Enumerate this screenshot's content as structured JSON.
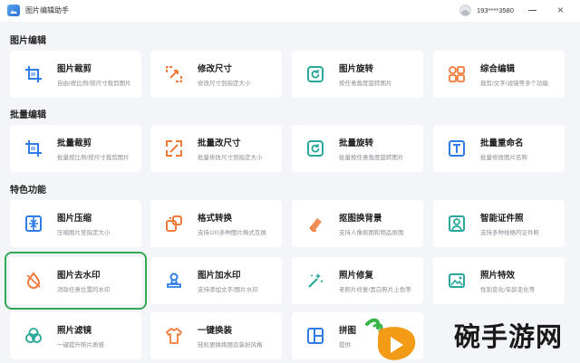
{
  "window": {
    "app_title": "图片编辑助手",
    "user_id": "193****3580",
    "minimize_glyph": "—",
    "close_glyph": "×"
  },
  "sections": {
    "picture_edit": "图片编辑",
    "batch_edit": "批量编辑",
    "features": "特色功能"
  },
  "cards": {
    "crop": {
      "name": "图片裁剪",
      "desc": "自由/按比例/按尺寸裁剪图片",
      "icon": "crop-icon"
    },
    "resize": {
      "name": "修改尺寸",
      "desc": "修改尺寸到指定大小",
      "icon": "resize-icon"
    },
    "rotate": {
      "name": "图片旋转",
      "desc": "按任意角度旋转图片",
      "icon": "rotate-icon"
    },
    "combo": {
      "name": "综合编辑",
      "desc": "裁剪/文字/滤镜等多个功能",
      "icon": "grid-icon"
    },
    "b_crop": {
      "name": "批量裁剪",
      "desc": "批量按比例/按尺寸裁剪图片",
      "icon": "crop-icon"
    },
    "b_resize": {
      "name": "批量改尺寸",
      "desc": "批量修改尺寸到指定大小",
      "icon": "resize-icon"
    },
    "b_rotate": {
      "name": "批量旋转",
      "desc": "批量按任意角度旋转图片",
      "icon": "rotate-icon"
    },
    "b_rename": {
      "name": "批量重命名",
      "desc": "批量修改图片名称",
      "icon": "text-icon"
    },
    "compress": {
      "name": "图片压缩",
      "desc": "压缩图片至指定大小",
      "icon": "compress-icon"
    },
    "convert": {
      "name": "格式转换",
      "desc": "支持100多种图片格式互换",
      "icon": "convert-icon"
    },
    "cutout": {
      "name": "抠图换背景",
      "desc": "支持人像抠图和物品抠图",
      "icon": "eraser-icon"
    },
    "id_photo": {
      "name": "智能证件照",
      "desc": "支持多种规格的证件照",
      "icon": "id-photo-icon"
    },
    "remove_wm": {
      "name": "图片去水印",
      "desc": "消除任意位置的水印",
      "icon": "drop-icon"
    },
    "add_wm": {
      "name": "图片加水印",
      "desc": "支持添加文字/图片水印",
      "icon": "stamp-icon"
    },
    "repair": {
      "name": "照片修复",
      "desc": "老照片修复/黑白照片上色等",
      "icon": "magic-wand-icon"
    },
    "effects": {
      "name": "照片特效",
      "desc": "性别变化/年龄变化等",
      "icon": "image-icon"
    },
    "filter": {
      "name": "照片滤镜",
      "desc": "一键提升照片质感",
      "icon": "filter-icon"
    },
    "outfit": {
      "name": "一键换装",
      "desc": "轻松更换绚丽及装扮风格",
      "icon": "shirt-icon"
    },
    "collage": {
      "name": "拼图",
      "desc": "提供",
      "icon": "collage-icon"
    }
  },
  "watermark": {
    "text": "碗手游网",
    "logo_icon": "play-logo-icon"
  },
  "colors": {
    "blue_icon": "#2f7be8",
    "orange_icon": "#f07a3a",
    "teal_icon": "#29a89a",
    "highlight_outline": "#32a852"
  }
}
